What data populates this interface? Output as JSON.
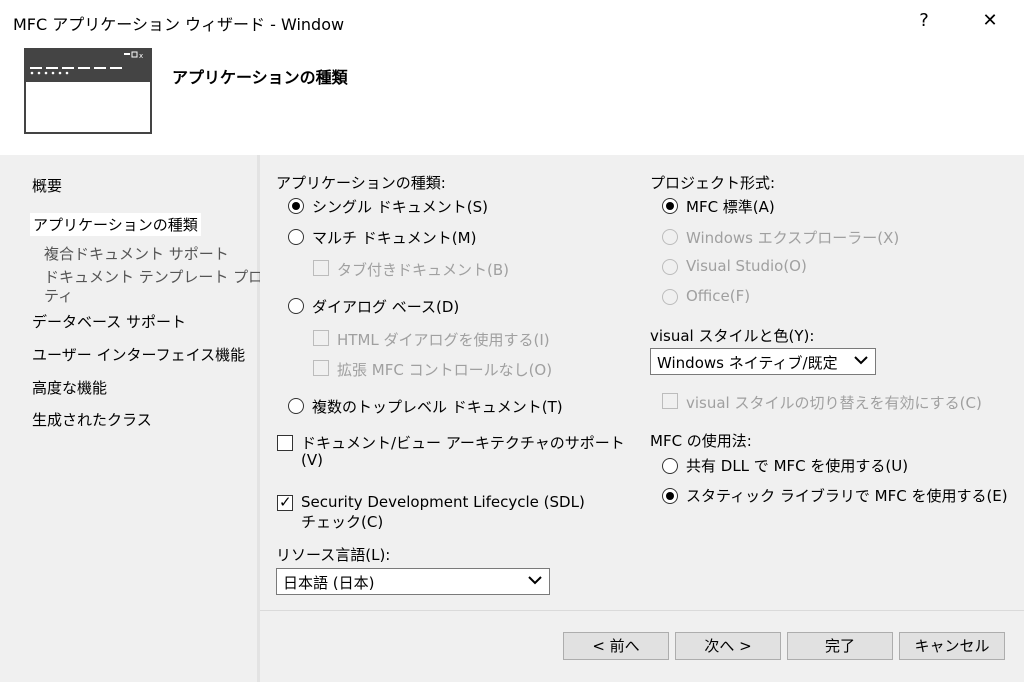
{
  "window": {
    "title": "MFC アプリケーション ウィザード - Window",
    "help_label": "?",
    "close_label": "✕"
  },
  "header": {
    "title": "アプリケーションの種類"
  },
  "sidebar": {
    "items": [
      {
        "label": "概要"
      },
      {
        "label": "アプリケーションの種類"
      },
      {
        "label": "複合ドキュメント サポート"
      },
      {
        "label": "ドキュメント テンプレート プロパ"
      },
      {
        "label": "ティ"
      },
      {
        "label": "データベース サポート"
      },
      {
        "label": "ユーザー インターフェイス機能"
      },
      {
        "label": "高度な機能"
      },
      {
        "label": "生成されたクラス"
      }
    ]
  },
  "app_type": {
    "label": "アプリケーションの種類:",
    "options": [
      {
        "label": "シングル ドキュメント(S)",
        "checked": true
      },
      {
        "label": "マルチ ドキュメント(M)",
        "checked": false
      },
      {
        "label": "ダイアログ ベース(D)",
        "checked": false
      },
      {
        "label": "複数のトップレベル ドキュメント(T)",
        "checked": false
      }
    ],
    "tabbed_doc": "タブ付きドキュメント(B)",
    "html_dialog": "HTML ダイアログを使用する(I)",
    "no_ext_mfc": "拡張 MFC コントロールなし(O)"
  },
  "doc_view": {
    "line1": "ドキュメント/ビュー アーキテクチャのサポート",
    "line2": "(V)"
  },
  "sdl": {
    "line1": "Security Development Lifecycle (SDL)",
    "line2": "チェック(C)"
  },
  "resource_lang": {
    "label": "リソース言語(L):",
    "value": "日本語 (日本)"
  },
  "project_style": {
    "label": "プロジェクト形式:",
    "options": [
      {
        "label": "MFC 標準(A)",
        "checked": true,
        "enabled": true
      },
      {
        "label": "Windows エクスプローラー(X)",
        "checked": false,
        "enabled": false
      },
      {
        "label": "Visual Studio(O)",
        "checked": false,
        "enabled": false
      },
      {
        "label": "Office(F)",
        "checked": false,
        "enabled": false
      }
    ]
  },
  "visual_style": {
    "label": "visual スタイルと色(Y):",
    "value": "Windows ネイティブ/既定",
    "toggle_label": "visual スタイルの切り替えを有効にする(C)"
  },
  "mfc_use": {
    "label": "MFC の使用法:",
    "options": [
      {
        "label": "共有 DLL で MFC を使用する(U)",
        "checked": false
      },
      {
        "label": "スタティック ライブラリで MFC を使用する(E)",
        "checked": true
      }
    ]
  },
  "buttons": {
    "prev": "< 前へ",
    "next": "次へ >",
    "finish": "完了",
    "cancel": "キャンセル"
  }
}
